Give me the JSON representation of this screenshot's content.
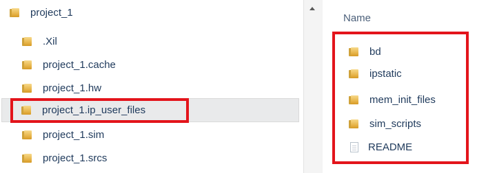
{
  "tree": {
    "items": [
      {
        "label": "project_1",
        "icon": "folder-icon"
      },
      {
        "label": ".Xil",
        "icon": "folder-icon"
      },
      {
        "label": "project_1.cache",
        "icon": "folder-icon"
      },
      {
        "label": "project_1.hw",
        "icon": "folder-icon"
      },
      {
        "label": "project_1.ip_user_files",
        "icon": "folder-icon",
        "selected": true
      },
      {
        "label": "project_1.sim",
        "icon": "folder-icon"
      },
      {
        "label": "project_1.srcs",
        "icon": "folder-icon"
      }
    ]
  },
  "file_list": {
    "column_header": "Name",
    "items": [
      {
        "label": "bd",
        "icon": "folder-icon"
      },
      {
        "label": "ipstatic",
        "icon": "folder-icon"
      },
      {
        "label": "mem_init_files",
        "icon": "folder-icon"
      },
      {
        "label": "sim_scripts",
        "icon": "folder-icon"
      },
      {
        "label": "README",
        "icon": "document-icon"
      }
    ]
  },
  "colors": {
    "highlight_box": "#e3141b",
    "selection_bg": "#e9eaeb",
    "text": "#1e395b",
    "folder": "#e8b64c"
  }
}
